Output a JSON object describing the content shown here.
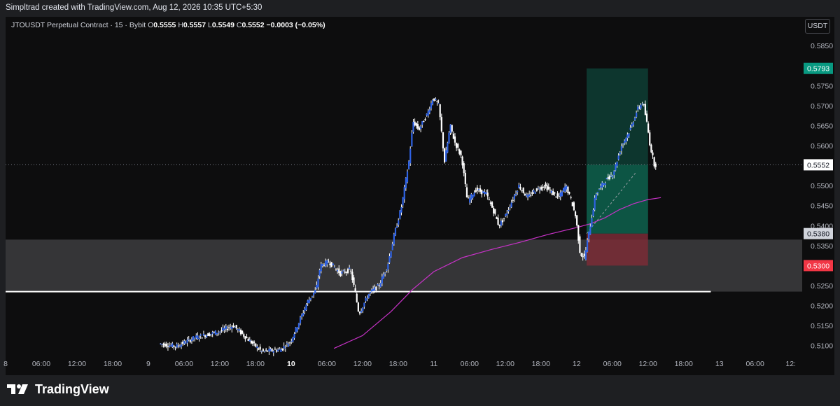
{
  "header": {
    "credit": "Simpltrad created with TradingView.com, Aug 12, 2026 10:35 UTC+5:30"
  },
  "legend": {
    "symbol": "JTOUSDT Perpetual Contract · 15 · Bybit",
    "o_label": "O",
    "o_value": "0.5555",
    "h_label": "H",
    "h_value": "0.5557",
    "l_label": "L",
    "l_value": "0.5549",
    "c_label": "C",
    "c_value": "0.5552",
    "change": "−0.0003 (−0.05%)"
  },
  "currency_button": "USDT",
  "footer": {
    "brand": "TradingView"
  },
  "colors": {
    "background": "#0d0d0e",
    "candle": "#2f63e6",
    "wick": "#ffffff",
    "moving_average": "#c832c8",
    "take_profit_zone": "#0e5a48",
    "stop_loss_zone": "#7a2c36",
    "support_zone": "#3a3a3c",
    "target_label": "#089981",
    "stop_label": "#f23645"
  },
  "chart_data": {
    "type": "candlestick",
    "interval": "15",
    "price_axis": {
      "ticks": [
        "0.5850",
        "0.5800",
        "0.5750",
        "0.5700",
        "0.5650",
        "0.5600",
        "0.5550",
        "0.5500",
        "0.5450",
        "0.5400",
        "0.5350",
        "0.5300",
        "0.5250",
        "0.5200",
        "0.5150",
        "0.5100"
      ],
      "ylim": [
        0.5075,
        0.588
      ]
    },
    "time_axis": {
      "ticks": [
        {
          "label": "8",
          "bold": false
        },
        {
          "label": "06:00",
          "bold": false
        },
        {
          "label": "12:00",
          "bold": false
        },
        {
          "label": "18:00",
          "bold": false
        },
        {
          "label": "9",
          "bold": false
        },
        {
          "label": "06:00",
          "bold": false
        },
        {
          "label": "12:00",
          "bold": false
        },
        {
          "label": "18:00",
          "bold": false
        },
        {
          "label": "10",
          "bold": true
        },
        {
          "label": "06:00",
          "bold": false
        },
        {
          "label": "12:00",
          "bold": false
        },
        {
          "label": "18:00",
          "bold": false
        },
        {
          "label": "11",
          "bold": false
        },
        {
          "label": "06:00",
          "bold": false
        },
        {
          "label": "12:00",
          "bold": false
        },
        {
          "label": "18:00",
          "bold": false
        },
        {
          "label": "12",
          "bold": false
        },
        {
          "label": "06:00",
          "bold": false
        },
        {
          "label": "12:00",
          "bold": false
        },
        {
          "label": "18:00",
          "bold": false
        },
        {
          "label": "13",
          "bold": false
        },
        {
          "label": "06:00",
          "bold": false
        },
        {
          "label": "12:",
          "bold": false
        }
      ]
    },
    "price_path": [
      [
        9.08,
        0.5105
      ],
      [
        9.2,
        0.5098
      ],
      [
        9.33,
        0.512
      ],
      [
        9.5,
        0.5135
      ],
      [
        9.6,
        0.515
      ],
      [
        9.72,
        0.511
      ],
      [
        9.8,
        0.5085
      ],
      [
        9.93,
        0.509
      ],
      [
        10.0,
        0.511
      ],
      [
        10.05,
        0.515
      ],
      [
        10.12,
        0.521
      ],
      [
        10.18,
        0.524
      ],
      [
        10.21,
        0.53
      ],
      [
        10.27,
        0.531
      ],
      [
        10.35,
        0.528
      ],
      [
        10.42,
        0.529
      ],
      [
        10.45,
        0.524
      ],
      [
        10.48,
        0.518
      ],
      [
        10.55,
        0.523
      ],
      [
        10.62,
        0.525
      ],
      [
        10.68,
        0.53
      ],
      [
        10.73,
        0.538
      ],
      [
        10.78,
        0.545
      ],
      [
        10.83,
        0.556
      ],
      [
        10.86,
        0.566
      ],
      [
        10.9,
        0.564
      ],
      [
        10.96,
        0.568
      ],
      [
        11.0,
        0.572
      ],
      [
        11.04,
        0.57
      ],
      [
        11.08,
        0.556
      ],
      [
        11.12,
        0.565
      ],
      [
        11.15,
        0.561
      ],
      [
        11.2,
        0.557
      ],
      [
        11.24,
        0.546
      ],
      [
        11.3,
        0.549
      ],
      [
        11.37,
        0.548
      ],
      [
        11.42,
        0.544
      ],
      [
        11.46,
        0.54
      ],
      [
        11.5,
        0.542
      ],
      [
        11.55,
        0.546
      ],
      [
        11.6,
        0.55
      ],
      [
        11.66,
        0.547
      ],
      [
        11.72,
        0.549
      ],
      [
        11.78,
        0.55
      ],
      [
        11.84,
        0.548
      ],
      [
        11.88,
        0.547
      ],
      [
        11.93,
        0.55
      ],
      [
        11.97,
        0.546
      ],
      [
        12.0,
        0.542
      ],
      [
        12.03,
        0.533
      ],
      [
        12.06,
        0.532
      ],
      [
        12.09,
        0.538
      ],
      [
        12.14,
        0.548
      ],
      [
        12.2,
        0.551
      ],
      [
        12.26,
        0.553
      ],
      [
        12.32,
        0.56
      ],
      [
        12.38,
        0.564
      ],
      [
        12.43,
        0.569
      ],
      [
        12.47,
        0.571
      ],
      [
        12.5,
        0.565
      ],
      [
        12.52,
        0.56
      ],
      [
        12.55,
        0.5552
      ]
    ],
    "moving_average": [
      [
        10.3,
        0.5093
      ],
      [
        10.5,
        0.5125
      ],
      [
        10.7,
        0.5185
      ],
      [
        10.85,
        0.524
      ],
      [
        11.0,
        0.5285
      ],
      [
        11.2,
        0.532
      ],
      [
        11.4,
        0.534
      ],
      [
        11.6,
        0.5358
      ],
      [
        11.8,
        0.5378
      ],
      [
        12.0,
        0.5395
      ],
      [
        12.1,
        0.5405
      ],
      [
        12.2,
        0.542
      ],
      [
        12.3,
        0.544
      ],
      [
        12.4,
        0.5455
      ],
      [
        12.5,
        0.5465
      ],
      [
        12.59,
        0.547
      ]
    ],
    "support_zone": {
      "top": 0.5365,
      "bottom": 0.5235
    },
    "support_line": 0.5235,
    "position": {
      "type": "long",
      "start": 12.07,
      "end": 12.5,
      "entry": 0.538,
      "target": 0.5793,
      "stop": 0.53,
      "current": 0.5552
    },
    "price_labels": {
      "target": "0.5793",
      "current": "0.5552",
      "entry": "0.5380",
      "stop": "0.5300"
    }
  }
}
